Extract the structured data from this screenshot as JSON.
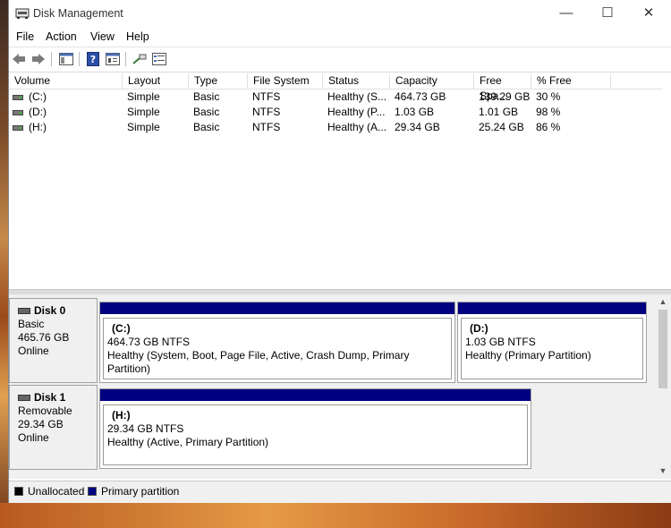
{
  "window": {
    "title": "Disk Management"
  },
  "menu": [
    "File",
    "Action",
    "View",
    "Help"
  ],
  "window_controls": {
    "minimize": "—",
    "maximize": "☐",
    "close": "✕"
  },
  "list": {
    "columns": [
      "Volume",
      "Layout",
      "Type",
      "File System",
      "Status",
      "Capacity",
      "Free Spa...",
      "% Free"
    ],
    "rows": [
      {
        "volume": "(C:)",
        "layout": "Simple",
        "type": "Basic",
        "fs": "NTFS",
        "status": "Healthy (S...",
        "capacity": "464.73 GB",
        "free": "139.29 GB",
        "pct": "30 %"
      },
      {
        "volume": "(D:)",
        "layout": "Simple",
        "type": "Basic",
        "fs": "NTFS",
        "status": "Healthy (P...",
        "capacity": "1.03 GB",
        "free": "1.01 GB",
        "pct": "98 %"
      },
      {
        "volume": "(H:)",
        "layout": "Simple",
        "type": "Basic",
        "fs": "NTFS",
        "status": "Healthy (A...",
        "capacity": "29.34 GB",
        "free": "25.24 GB",
        "pct": "86 %"
      }
    ]
  },
  "disks": [
    {
      "name": "Disk 0",
      "kind": "Basic",
      "size": "465.76 GB",
      "state": "Online",
      "partitions": [
        {
          "name": "(C:)",
          "size": "464.73 GB NTFS",
          "status": "Healthy (System, Boot, Page File, Active, Crash Dump, Primary Partition)"
        },
        {
          "name": "(D:)",
          "size": "1.03 GB NTFS",
          "status": "Healthy (Primary Partition)"
        }
      ]
    },
    {
      "name": "Disk 1",
      "kind": "Removable",
      "size": "29.34 GB",
      "state": "Online",
      "partitions": [
        {
          "name": "(H:)",
          "size": "29.34 GB NTFS",
          "status": "Healthy (Active, Primary Partition)"
        }
      ]
    }
  ],
  "legend": [
    {
      "label": "Unallocated",
      "color": "#000000"
    },
    {
      "label": "Primary partition",
      "color": "#000080"
    }
  ]
}
